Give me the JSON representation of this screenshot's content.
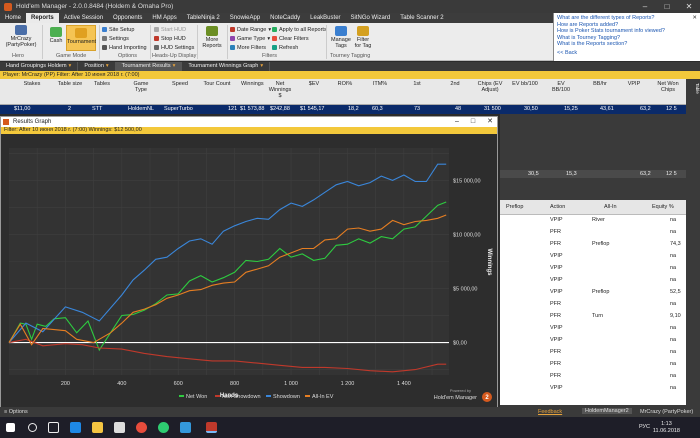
{
  "window": {
    "title": "Hold'em Manager - 2.0.0.8484 (Holdem & Omaha Pro)"
  },
  "tabs": [
    "Home",
    "Reports",
    "Active Session",
    "Opponents",
    "HM Apps",
    "TableNinja 2",
    "SnowieApp",
    "NoteCaddy",
    "LeakBuster",
    "SitNGo Wizard",
    "Table Scanner 2"
  ],
  "ribbon": {
    "hero_label": "MrCrazy (PartyPoker)",
    "cash_label": "Cash",
    "tournament_label": "Tournament",
    "site_setup": "Site Setup",
    "settings": "Settings",
    "hand_importing": "Hand Importing",
    "start_hud": "Start HUD",
    "stop_hud": "Stop HUD",
    "hud_settings": "HUD Settings",
    "more_reports": "More Reports",
    "date_range": "Date Range",
    "game_type": "Game Type",
    "more_filters": "More Filters",
    "apply_all": "Apply to all Reports",
    "clear_filters": "Clear Filters",
    "refresh": "Refresh",
    "manage_tags": "Manage Tags",
    "filter_for_tag": "Filter for Tag",
    "groups": {
      "hero": "Hero",
      "game_mode": "Game Mode",
      "options": "Options",
      "hud": "Heads-Up Display",
      "filters": "Filters",
      "tagging": "Tourney Tagging"
    }
  },
  "help": {
    "links": [
      "What are the different types of Reports?",
      "How are Reports added?",
      "How is Poker Stats tournament info viewed?",
      "What is Tourney Tagging?",
      "What is the Reports section?"
    ],
    "back": "<< Back"
  },
  "section_tabs": [
    "Hand Groupings Holdem",
    "Position",
    "Tournament Results",
    "Tournament Winnings Graph"
  ],
  "filterbar": "Player:  MrCrazy (PP)   Filter: After 10 июня 2018 г. (7:00)",
  "grid": {
    "headers": [
      "Stakes",
      "Table size",
      "Tables",
      "Game Type",
      "Speed",
      "Tour Count",
      "Winnings",
      "Net Winnings $",
      "$EV",
      "ROI%",
      "ITM%",
      "1st",
      "2nd",
      "Chips (EV Adjust)",
      "EV bb/100",
      "EV BB/100",
      "BB/hr",
      "VPIP",
      "Net Won Chips"
    ],
    "row": [
      "$11,00",
      "2",
      "STT",
      "HoldemNL",
      "SuperTurbo",
      "121",
      "$1 573,88",
      "$242,88",
      "$1 545,17",
      "18,2",
      "60,3",
      "73",
      "48",
      "31 500",
      "30,50",
      "15,25",
      "43,61",
      "63,2",
      "12 5"
    ],
    "totals": [
      "30,5",
      "15,3",
      "63,2",
      "12 5"
    ]
  },
  "panel": {
    "headers": [
      "Preflop",
      "Action",
      "All-In",
      "Equity %"
    ],
    "actions": [
      "VPIP",
      "PFR",
      "PFR",
      "VPIP",
      "VPIP",
      "VPIP",
      "VPIP",
      "PFR",
      "PFR",
      "VPIP",
      "VPIP",
      "PFR",
      "PFR",
      "PFR",
      "VPIP"
    ],
    "allin": [
      "River",
      "Preflop",
      "Preflop",
      "Turn"
    ],
    "equity": [
      "na",
      "na",
      "74,3",
      "na",
      "na",
      "na",
      "52,5",
      "na",
      "9,10",
      "na",
      "na",
      "na",
      "na",
      "na",
      "na"
    ]
  },
  "results": {
    "title": "Results Graph",
    "filter": "Filter: After 10 июня 2018 г. (7:00)  Winnings: $12 500,00",
    "options": "Options",
    "powered": "Powered by",
    "brand": "Hold'em Manager"
  },
  "chart_data": {
    "type": "line",
    "xlabel": "Hands",
    "ylabel": "Winnings",
    "xlim": [
      0,
      1560
    ],
    "ylim": [
      -3000,
      18000
    ],
    "x_ticks": [
      "200",
      "400",
      "600",
      "800",
      "1 000",
      "1 200",
      "1 400"
    ],
    "y_ticks": [
      "$0,00",
      "$5 000,00",
      "$10 000,00",
      "$15 000,00"
    ],
    "series": [
      {
        "name": "Net Won",
        "color": "#2ecc40",
        "points": [
          [
            0,
            0
          ],
          [
            40,
            1800
          ],
          [
            60,
            1700
          ],
          [
            80,
            300
          ],
          [
            100,
            1700
          ],
          [
            130,
            1500
          ],
          [
            160,
            2200
          ],
          [
            200,
            2300
          ],
          [
            240,
            900
          ],
          [
            280,
            2000
          ],
          [
            320,
            -700
          ],
          [
            360,
            900
          ],
          [
            400,
            2500
          ],
          [
            440,
            2600
          ],
          [
            480,
            3000
          ],
          [
            520,
            3600
          ],
          [
            560,
            4400
          ],
          [
            600,
            4500
          ],
          [
            640,
            5700
          ],
          [
            680,
            6200
          ],
          [
            720,
            5600
          ],
          [
            760,
            6000
          ],
          [
            800,
            6500
          ],
          [
            840,
            7600
          ],
          [
            880,
            7500
          ],
          [
            920,
            7700
          ],
          [
            960,
            8700
          ],
          [
            1000,
            7900
          ],
          [
            1040,
            8200
          ],
          [
            1080,
            7600
          ],
          [
            1120,
            7800
          ],
          [
            1160,
            9000
          ],
          [
            1200,
            9100
          ],
          [
            1240,
            9600
          ],
          [
            1280,
            9200
          ],
          [
            1320,
            9800
          ],
          [
            1360,
            9600
          ],
          [
            1400,
            10500
          ],
          [
            1440,
            10700
          ],
          [
            1480,
            11700
          ],
          [
            1520,
            12700
          ],
          [
            1550,
            13000
          ]
        ]
      },
      {
        "name": "Non Showdown",
        "color": "#c0392b",
        "points": [
          [
            0,
            0
          ],
          [
            60,
            300
          ],
          [
            120,
            -300
          ],
          [
            200,
            -100
          ],
          [
            260,
            -200
          ],
          [
            320,
            -500
          ],
          [
            400,
            -600
          ],
          [
            480,
            -1000
          ],
          [
            560,
            -1300
          ],
          [
            640,
            -1500
          ],
          [
            720,
            -1700
          ],
          [
            800,
            -1700
          ],
          [
            880,
            -1900
          ],
          [
            960,
            -2100
          ],
          [
            1040,
            -2300
          ],
          [
            1120,
            -2300
          ],
          [
            1200,
            -2400
          ],
          [
            1280,
            -2600
          ],
          [
            1360,
            -2700
          ],
          [
            1440,
            -2500
          ],
          [
            1520,
            -2000
          ],
          [
            1550,
            -2000
          ]
        ]
      },
      {
        "name": "Showdown",
        "color": "#3a86d9",
        "points": [
          [
            0,
            0
          ],
          [
            60,
            1800
          ],
          [
            120,
            1000
          ],
          [
            200,
            3300
          ],
          [
            260,
            2800
          ],
          [
            320,
            2000
          ],
          [
            400,
            4400
          ],
          [
            440,
            5800
          ],
          [
            480,
            6700
          ],
          [
            520,
            7700
          ],
          [
            560,
            7900
          ],
          [
            600,
            8700
          ],
          [
            640,
            9400
          ],
          [
            680,
            9600
          ],
          [
            720,
            9100
          ],
          [
            760,
            10300
          ],
          [
            800,
            10800
          ],
          [
            840,
            11200
          ],
          [
            880,
            11500
          ],
          [
            920,
            11400
          ],
          [
            960,
            12300
          ],
          [
            1000,
            12900
          ],
          [
            1040,
            12600
          ],
          [
            1080,
            13200
          ],
          [
            1120,
            13900
          ],
          [
            1160,
            14600
          ],
          [
            1200,
            14900
          ],
          [
            1240,
            14500
          ],
          [
            1280,
            14800
          ],
          [
            1320,
            15400
          ],
          [
            1360,
            15000
          ],
          [
            1400,
            15500
          ],
          [
            1440,
            14900
          ],
          [
            1480,
            14900
          ],
          [
            1520,
            16500
          ],
          [
            1550,
            16500
          ]
        ]
      },
      {
        "name": "All-In EV",
        "color": "#e67e22",
        "points": [
          [
            0,
            0
          ],
          [
            40,
            1700
          ],
          [
            80,
            -200
          ],
          [
            120,
            1300
          ],
          [
            200,
            1100
          ],
          [
            240,
            300
          ],
          [
            300,
            0
          ],
          [
            360,
            900
          ],
          [
            400,
            1800
          ],
          [
            440,
            2800
          ],
          [
            480,
            3100
          ],
          [
            520,
            3500
          ],
          [
            560,
            4100
          ],
          [
            600,
            4400
          ],
          [
            640,
            4800
          ],
          [
            680,
            4900
          ],
          [
            720,
            5300
          ],
          [
            760,
            5500
          ],
          [
            800,
            5600
          ],
          [
            840,
            6500
          ],
          [
            880,
            6800
          ],
          [
            920,
            7100
          ],
          [
            960,
            7900
          ],
          [
            1000,
            8300
          ],
          [
            1040,
            8700
          ],
          [
            1080,
            8700
          ],
          [
            1120,
            9500
          ],
          [
            1160,
            9600
          ],
          [
            1200,
            10500
          ],
          [
            1240,
            10600
          ],
          [
            1280,
            10300
          ],
          [
            1320,
            10500
          ],
          [
            1360,
            11300
          ],
          [
            1400,
            10900
          ],
          [
            1440,
            11200
          ],
          [
            1480,
            11300
          ],
          [
            1520,
            11500
          ],
          [
            1550,
            11800
          ]
        ]
      }
    ]
  },
  "status": {
    "feedback": "Feedback",
    "app": "HoldemManager2",
    "player": "MrCrazy (PartyPoker)"
  },
  "taskbar": {
    "lang": "РУС",
    "time": "1:13",
    "date": "11.06.2018"
  },
  "colors": {
    "accent": "#f3c83b",
    "brand": "#d65a1e",
    "selected_row": "#0a2a6a"
  }
}
